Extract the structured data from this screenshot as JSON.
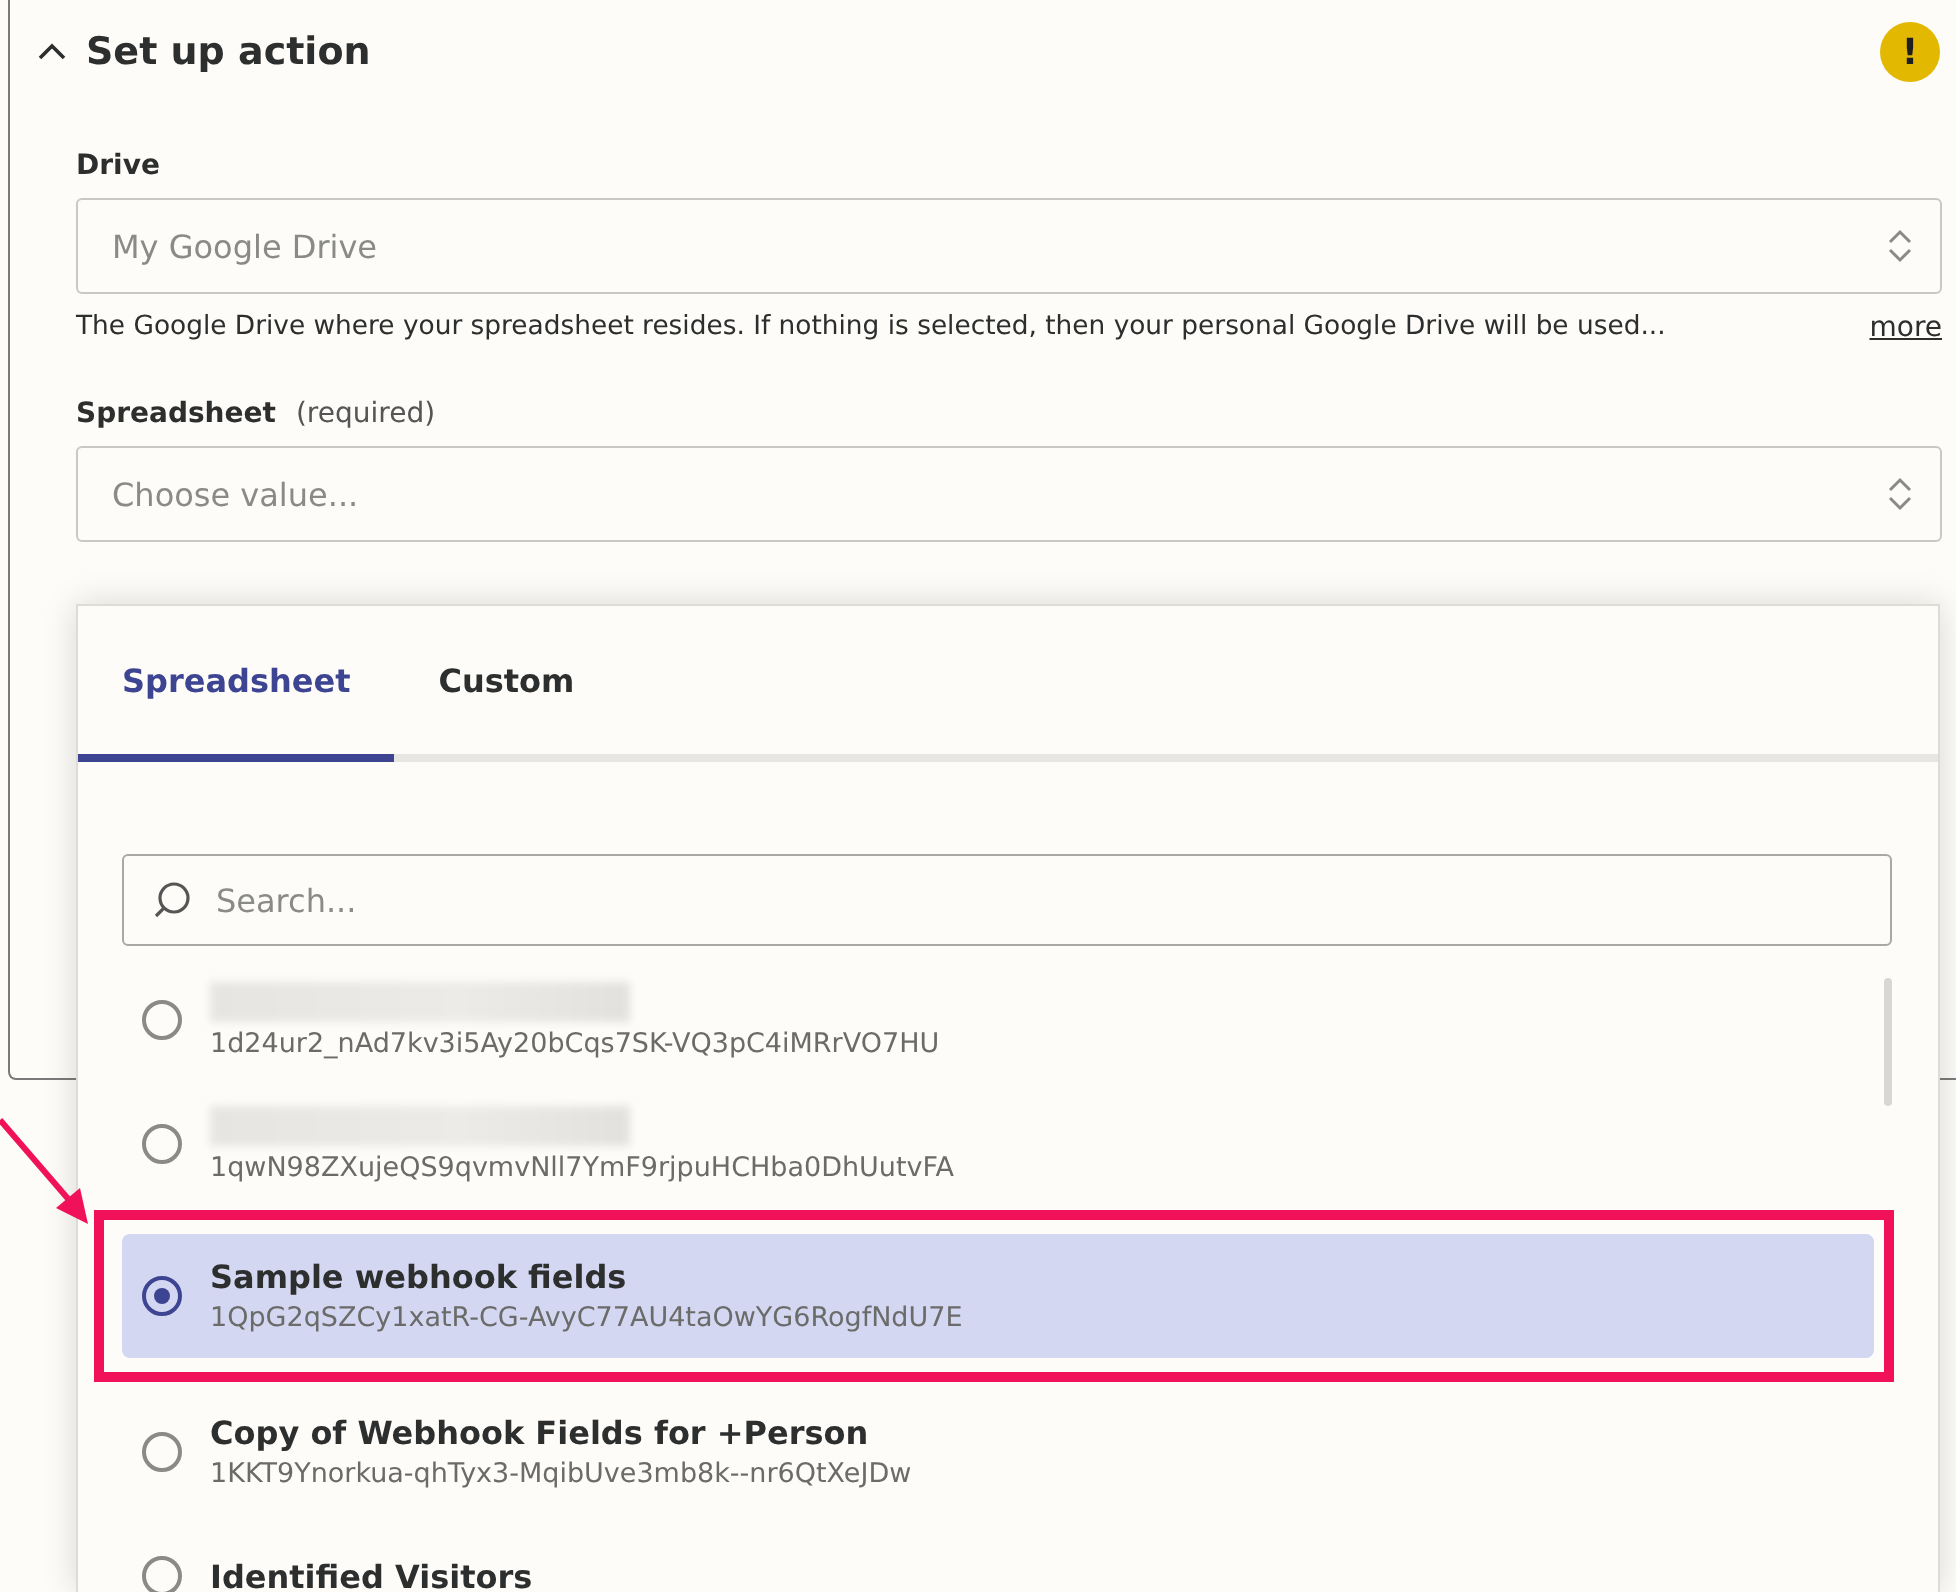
{
  "section": {
    "title": "Set up action",
    "warning": "!",
    "expanded": true
  },
  "fields": [
    {
      "label": "Drive",
      "value": "My Google Drive",
      "help": "The Google Drive where your spreadsheet resides. If nothing is selected, then your personal Google Drive will be used...",
      "more_link": "more"
    },
    {
      "label": "Spreadsheet",
      "required_note": "(required)",
      "placeholder": "Choose value..."
    }
  ],
  "dropdown": {
    "tabs": [
      {
        "label": "Spreadsheet",
        "selected": true
      },
      {
        "label": "Custom",
        "selected": false
      }
    ],
    "search": {
      "placeholder": "Search..."
    },
    "items": [
      {
        "kind": "redacted",
        "id": "1d24ur2_nAd7kv3i5Ay20bCqs7SK-VQ3pC4iMRrVO7HU",
        "selected": false,
        "highlighted": false
      },
      {
        "kind": "redacted",
        "id": "1qwN98ZXujeQS9qvmvNll7YmF9rjpuHCHba0DhUutvFA",
        "selected": false,
        "highlighted": false
      },
      {
        "kind": "named",
        "title": "Sample webhook fields",
        "id": "1QpG2qSZCy1xatR-CG-AvyC77AU4taOwYG6RogfNdU7E",
        "selected": true,
        "highlighted": true
      },
      {
        "kind": "named",
        "title": "Copy of Webhook Fields for +Person",
        "id": "1KKT9Ynorkua-qhTyx3-MqibUve3mb8k--nr6QtXeJDw",
        "selected": false,
        "highlighted": false
      },
      {
        "kind": "named",
        "title": "Identified Visitors",
        "selected": false,
        "highlighted": false
      }
    ]
  }
}
